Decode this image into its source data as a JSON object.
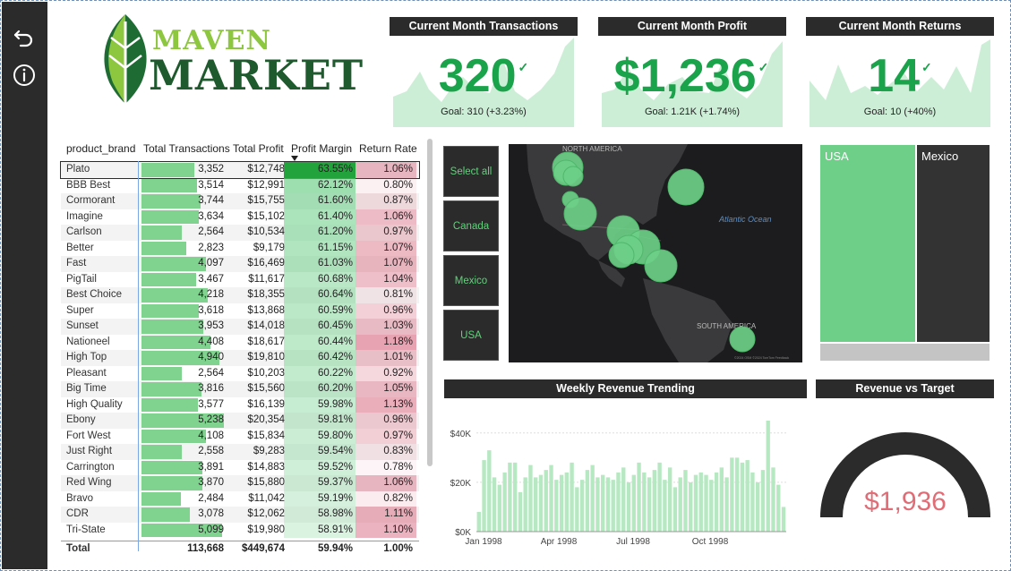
{
  "sidebar": {
    "back_icon": "back-arrow-icon",
    "info_icon": "info-icon"
  },
  "logo": {
    "line1": "MAVEN",
    "line2": "MARKET"
  },
  "kpis": [
    {
      "title": "Current Month Transactions",
      "value": "320",
      "goal": "Goal: 310 (+3.23%)"
    },
    {
      "title": "Current Month Profit",
      "value": "$1,236",
      "goal": "Goal: 1.21K (+1.74%)"
    },
    {
      "title": "Current Month Returns",
      "value": "14",
      "goal": "Goal: 10 (+40%)"
    }
  ],
  "table": {
    "headers": [
      "product_brand",
      "Total Transactions",
      "Total Profit",
      "Profit Margin",
      "Return Rate"
    ],
    "rows": [
      {
        "brand": "Plato",
        "trans": "3,352",
        "trans_n": 3352,
        "profit": "$12,748",
        "margin": "63.55%",
        "margin_n": 63.55,
        "ret": "1.06%",
        "ret_n": 1.06
      },
      {
        "brand": "BBB Best",
        "trans": "3,514",
        "trans_n": 3514,
        "profit": "$12,991",
        "margin": "62.12%",
        "margin_n": 62.12,
        "ret": "0.80%",
        "ret_n": 0.8
      },
      {
        "brand": "Cormorant",
        "trans": "3,744",
        "trans_n": 3744,
        "profit": "$15,755",
        "margin": "61.60%",
        "margin_n": 61.6,
        "ret": "0.87%",
        "ret_n": 0.87
      },
      {
        "brand": "Imagine",
        "trans": "3,634",
        "trans_n": 3634,
        "profit": "$15,102",
        "margin": "61.40%",
        "margin_n": 61.4,
        "ret": "1.06%",
        "ret_n": 1.06
      },
      {
        "brand": "Carlson",
        "trans": "2,564",
        "trans_n": 2564,
        "profit": "$10,534",
        "margin": "61.20%",
        "margin_n": 61.2,
        "ret": "0.97%",
        "ret_n": 0.97
      },
      {
        "brand": "Better",
        "trans": "2,823",
        "trans_n": 2823,
        "profit": "$9,179",
        "margin": "61.15%",
        "margin_n": 61.15,
        "ret": "1.07%",
        "ret_n": 1.07
      },
      {
        "brand": "Fast",
        "trans": "4,097",
        "trans_n": 4097,
        "profit": "$16,469",
        "margin": "61.03%",
        "margin_n": 61.03,
        "ret": "1.07%",
        "ret_n": 1.07
      },
      {
        "brand": "PigTail",
        "trans": "3,467",
        "trans_n": 3467,
        "profit": "$11,617",
        "margin": "60.68%",
        "margin_n": 60.68,
        "ret": "1.04%",
        "ret_n": 1.04
      },
      {
        "brand": "Best Choice",
        "trans": "4,218",
        "trans_n": 4218,
        "profit": "$18,355",
        "margin": "60.64%",
        "margin_n": 60.64,
        "ret": "0.81%",
        "ret_n": 0.81
      },
      {
        "brand": "Super",
        "trans": "3,618",
        "trans_n": 3618,
        "profit": "$13,868",
        "margin": "60.59%",
        "margin_n": 60.59,
        "ret": "0.96%",
        "ret_n": 0.96
      },
      {
        "brand": "Sunset",
        "trans": "3,953",
        "trans_n": 3953,
        "profit": "$14,018",
        "margin": "60.45%",
        "margin_n": 60.45,
        "ret": "1.03%",
        "ret_n": 1.03
      },
      {
        "brand": "Nationeel",
        "trans": "4,408",
        "trans_n": 4408,
        "profit": "$18,617",
        "margin": "60.44%",
        "margin_n": 60.44,
        "ret": "1.18%",
        "ret_n": 1.18
      },
      {
        "brand": "High Top",
        "trans": "4,940",
        "trans_n": 4940,
        "profit": "$19,810",
        "margin": "60.42%",
        "margin_n": 60.42,
        "ret": "1.01%",
        "ret_n": 1.01
      },
      {
        "brand": "Pleasant",
        "trans": "2,564",
        "trans_n": 2564,
        "profit": "$10,203",
        "margin": "60.22%",
        "margin_n": 60.22,
        "ret": "0.92%",
        "ret_n": 0.92
      },
      {
        "brand": "Big Time",
        "trans": "3,816",
        "trans_n": 3816,
        "profit": "$15,560",
        "margin": "60.20%",
        "margin_n": 60.2,
        "ret": "1.05%",
        "ret_n": 1.05
      },
      {
        "brand": "High Quality",
        "trans": "3,577",
        "trans_n": 3577,
        "profit": "$16,139",
        "margin": "59.98%",
        "margin_n": 59.98,
        "ret": "1.13%",
        "ret_n": 1.13
      },
      {
        "brand": "Ebony",
        "trans": "5,238",
        "trans_n": 5238,
        "profit": "$20,354",
        "margin": "59.81%",
        "margin_n": 59.81,
        "ret": "0.96%",
        "ret_n": 0.96
      },
      {
        "brand": "Fort West",
        "trans": "4,108",
        "trans_n": 4108,
        "profit": "$15,834",
        "margin": "59.80%",
        "margin_n": 59.8,
        "ret": "0.97%",
        "ret_n": 0.97
      },
      {
        "brand": "Just Right",
        "trans": "2,558",
        "trans_n": 2558,
        "profit": "$9,283",
        "margin": "59.54%",
        "margin_n": 59.54,
        "ret": "0.83%",
        "ret_n": 0.83
      },
      {
        "brand": "Carrington",
        "trans": "3,891",
        "trans_n": 3891,
        "profit": "$14,883",
        "margin": "59.52%",
        "margin_n": 59.52,
        "ret": "0.78%",
        "ret_n": 0.78
      },
      {
        "brand": "Red Wing",
        "trans": "3,870",
        "trans_n": 3870,
        "profit": "$15,880",
        "margin": "59.37%",
        "margin_n": 59.37,
        "ret": "1.06%",
        "ret_n": 1.06
      },
      {
        "brand": "Bravo",
        "trans": "2,484",
        "trans_n": 2484,
        "profit": "$11,042",
        "margin": "59.19%",
        "margin_n": 59.19,
        "ret": "0.82%",
        "ret_n": 0.82
      },
      {
        "brand": "CDR",
        "trans": "3,078",
        "trans_n": 3078,
        "profit": "$12,062",
        "margin": "58.98%",
        "margin_n": 58.98,
        "ret": "1.11%",
        "ret_n": 1.11
      },
      {
        "brand": "Tri-State",
        "trans": "5,099",
        "trans_n": 5099,
        "profit": "$19,980",
        "margin": "58.91%",
        "margin_n": 58.91,
        "ret": "1.10%",
        "ret_n": 1.1
      }
    ],
    "total": {
      "label": "Total",
      "trans": "113,668",
      "profit": "$449,674",
      "margin": "59.94%",
      "ret": "1.00%"
    }
  },
  "slicer": {
    "options": [
      "Select all",
      "Canada",
      "Mexico",
      "USA"
    ]
  },
  "map": {
    "label_north_america": "NORTH AMERICA",
    "label_atlantic": "Atlantic Ocean",
    "label_south_america": "SOUTH AMERICA",
    "attribution": "©2024 OSM ©2024 TomTom Feedback"
  },
  "treemap": {
    "items": [
      {
        "label": "USA",
        "color": "#6dcf88"
      },
      {
        "label": "Mexico",
        "color": "#333333"
      }
    ]
  },
  "weekly_chart": {
    "title": "Weekly Revenue Trending"
  },
  "gauge": {
    "title": "Revenue vs Target",
    "value_label": "$1,936",
    "fill_fraction": 1.0,
    "value_color": "#e06c75"
  },
  "colors": {
    "accent_green": "#1aa34a",
    "bar_green": "#7fd38e",
    "dark": "#2b2b2b"
  },
  "chart_data": {
    "type": "bar",
    "title": "Weekly Revenue Trending",
    "xlabel": "",
    "ylabel": "",
    "ylim": [
      0,
      45000
    ],
    "yticks": [
      "$0K",
      "$20K",
      "$40K"
    ],
    "xticks": [
      "Jan 1998",
      "Apr 1998",
      "Jul 1998",
      "Oct 1998"
    ],
    "values": [
      8000,
      29000,
      33000,
      22000,
      19000,
      24000,
      28000,
      28000,
      16000,
      22000,
      27000,
      22000,
      23000,
      25000,
      27000,
      21000,
      23000,
      24000,
      28000,
      18000,
      21000,
      25000,
      27000,
      22000,
      23000,
      22000,
      21000,
      24000,
      26000,
      20000,
      23000,
      28000,
      24000,
      22000,
      25000,
      28000,
      21000,
      26000,
      18000,
      22000,
      25000,
      20000,
      23000,
      24000,
      23000,
      21000,
      24000,
      26000,
      22000,
      30000,
      30000,
      28000,
      29000,
      24000,
      20000,
      25000,
      45000,
      26000,
      19000,
      10000
    ]
  }
}
